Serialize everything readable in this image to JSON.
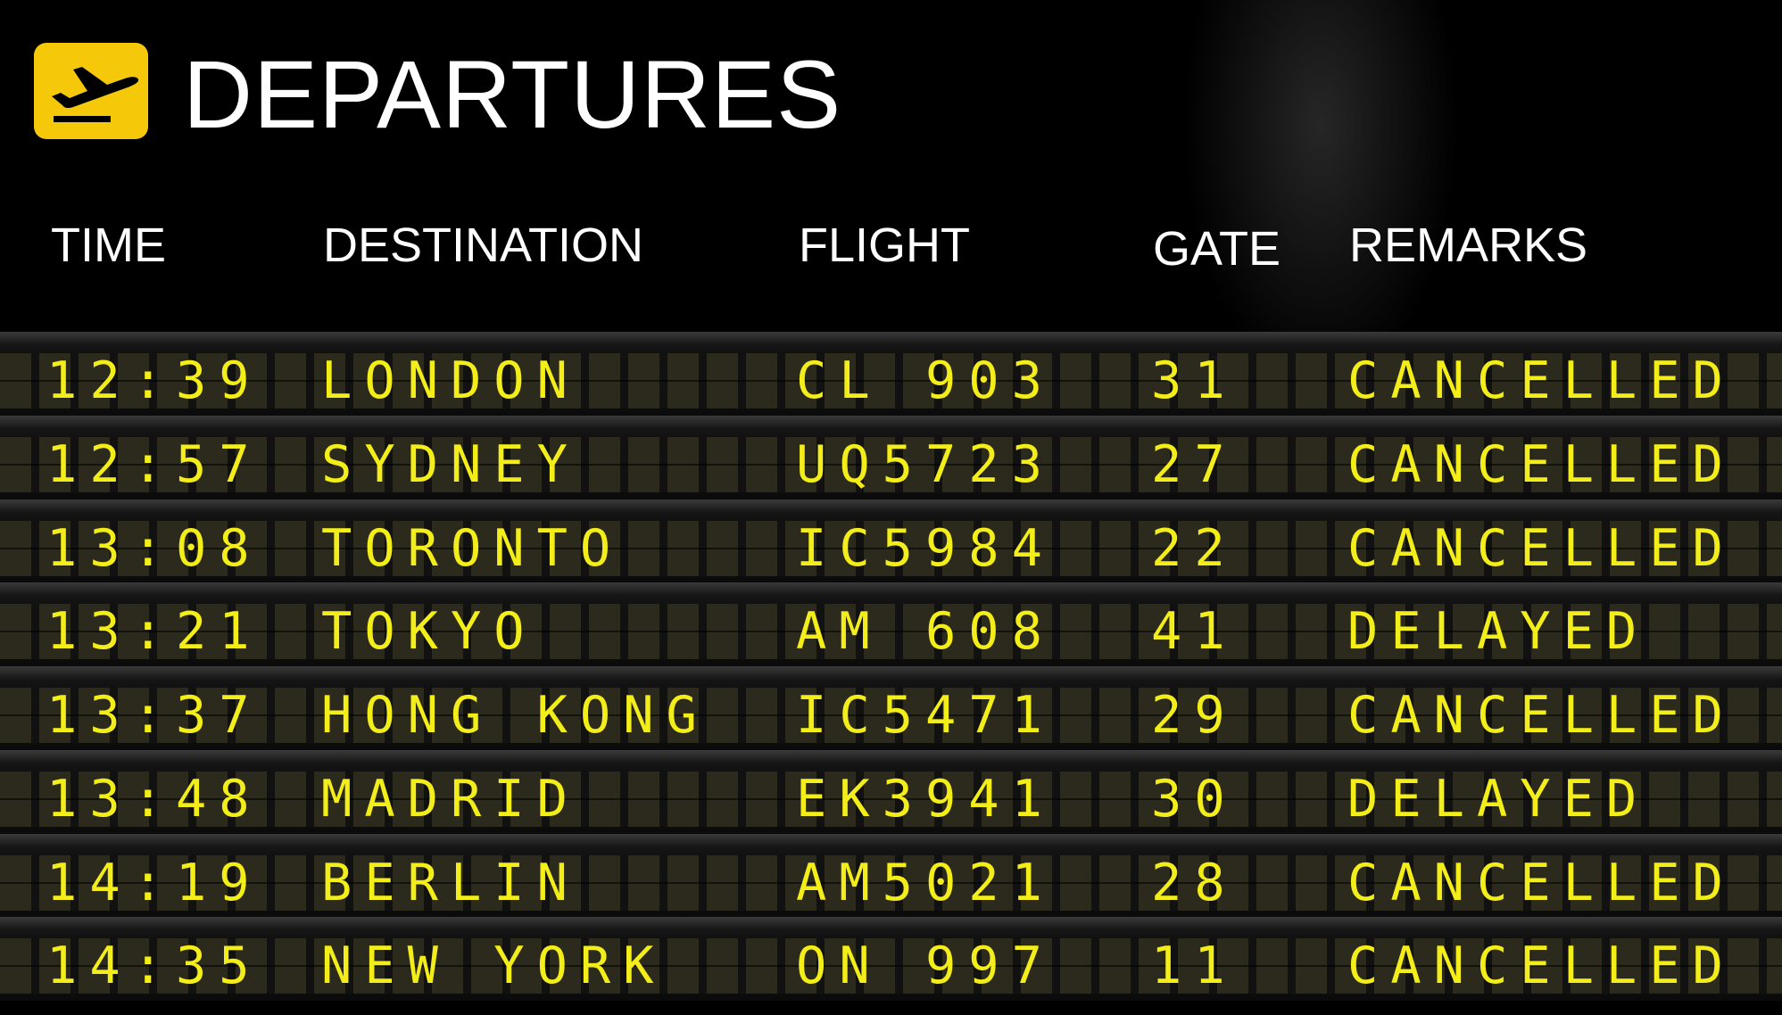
{
  "header": {
    "title": "DEPARTURES",
    "icon": "airplane-departure-icon",
    "accent_color": "#f6c80a"
  },
  "columns": {
    "time": "TIME",
    "destination": "DESTINATION",
    "flight": "FLIGHT",
    "gate": "GATE",
    "remarks": "REMARKS"
  },
  "rows": [
    {
      "time": "12:39",
      "destination": "LONDON",
      "flight": "CL 903",
      "gate": "31",
      "remarks": "CANCELLED"
    },
    {
      "time": "12:57",
      "destination": "SYDNEY",
      "flight": "UQ5723",
      "gate": "27",
      "remarks": "CANCELLED"
    },
    {
      "time": "13:08",
      "destination": "TORONTO",
      "flight": "IC5984",
      "gate": "22",
      "remarks": "CANCELLED"
    },
    {
      "time": "13:21",
      "destination": "TOKYO",
      "flight": "AM 608",
      "gate": "41",
      "remarks": "DELAYED"
    },
    {
      "time": "13:37",
      "destination": "HONG KONG",
      "flight": "IC5471",
      "gate": "29",
      "remarks": "CANCELLED"
    },
    {
      "time": "13:48",
      "destination": "MADRID",
      "flight": "EK3941",
      "gate": "30",
      "remarks": "DELAYED"
    },
    {
      "time": "14:19",
      "destination": "BERLIN",
      "flight": "AM5021",
      "gate": "28",
      "remarks": "CANCELLED"
    },
    {
      "time": "14:35",
      "destination": "NEW YORK",
      "flight": "ON 997",
      "gate": "11",
      "remarks": "CANCELLED"
    }
  ],
  "colors": {
    "text_yellow": "#f3ee1a",
    "heading_white": "#ffffff",
    "background": "#000000"
  }
}
